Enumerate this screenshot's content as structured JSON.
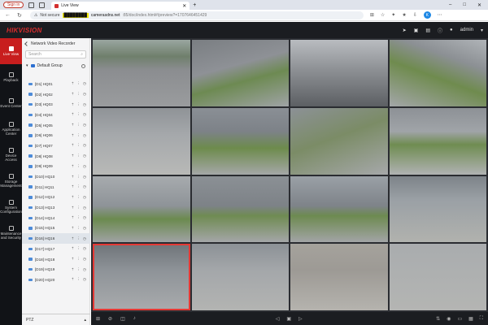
{
  "browser": {
    "sign_in": "Sign in",
    "tab_title": "Live View",
    "tab_close": "✕",
    "new_tab": "+",
    "nav_back": "←",
    "nav_reload": "↻",
    "security": "Not secure",
    "host_masked": "████████",
    "host_suffix": "camerasdns.net",
    "path": ":85/doc/index.html#/preview?=1707646451429",
    "profile_letter": "K"
  },
  "app": {
    "logo": "HIKVISION",
    "user": "admin"
  },
  "leftnav": [
    {
      "label": "Live View",
      "name": "live-view"
    },
    {
      "label": "Playback",
      "name": "playback"
    },
    {
      "label": "Event Center",
      "name": "event-center"
    },
    {
      "label": "Application Center",
      "name": "application-center"
    },
    {
      "label": "Device Access",
      "name": "device-access"
    },
    {
      "label": "Storage Management",
      "name": "storage-management"
    },
    {
      "label": "System Configuration",
      "name": "system-configuration"
    },
    {
      "label": "Maintenance and Security",
      "name": "maintenance-and-security"
    }
  ],
  "devices": {
    "title": "Network Video Recorder",
    "search_placeholder": "Search",
    "group": "Default Group",
    "channels": [
      "[D1] HQ01",
      "[D2] HQ02",
      "[D3] HQ03",
      "[D4] HQ04",
      "[D5] HQ05",
      "[D6] HQ06",
      "[D7] HQ07",
      "[D8] HQ08",
      "[D9] HQ09",
      "[D10] HQ10",
      "[D11] HQ11",
      "[D12] HQ12",
      "[D13] HQ13",
      "[D14] HQ14",
      "[D15] HQ15",
      "[D16] HQ16",
      "[D17] HQ17",
      "[D18] HQ18",
      "[D19] HQ19",
      "[D20] HQ20"
    ],
    "selected_index": 15,
    "ptz": "PTZ"
  },
  "colors": {
    "brand_red": "#d72c2c",
    "active_nav": "#c81e1e"
  }
}
